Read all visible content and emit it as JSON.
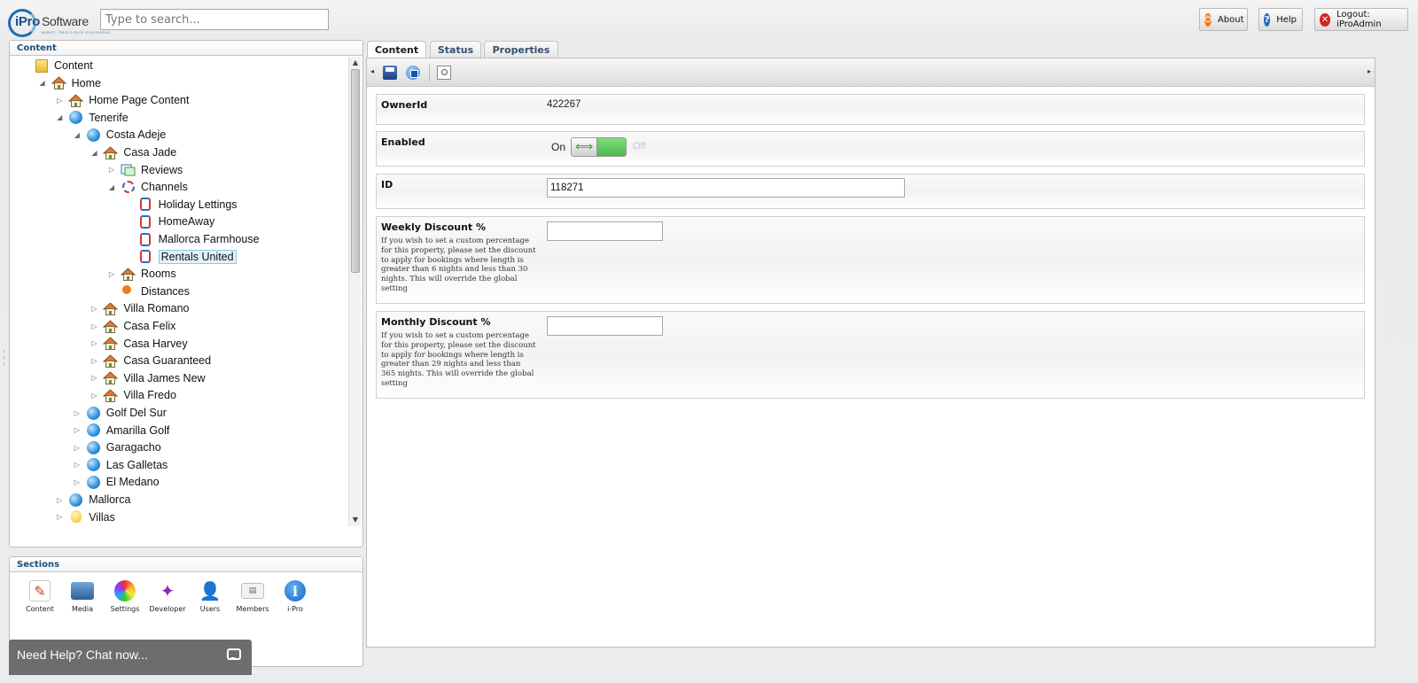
{
  "app": {
    "logo_text": "iPro",
    "logo_text2": "Software",
    "logo_tagline": "MARKET, TRACK & BOOK YOUR RENTALS",
    "search_placeholder": "Type to search..."
  },
  "topbar": {
    "about": "About",
    "help": "Help",
    "logout": "Logout: iProAdmin"
  },
  "content_panel": {
    "title": "Content",
    "tree": [
      {
        "label": "Content",
        "icon": "folder-icon",
        "toggle": ""
      },
      {
        "label": "Home",
        "icon": "house-icon",
        "toggle": "expanded"
      },
      {
        "label": "Home Page Content",
        "icon": "house-icon",
        "toggle": "collapsed"
      },
      {
        "label": "Tenerife",
        "icon": "globe-icon",
        "toggle": "expanded"
      },
      {
        "label": "Costa Adeje",
        "icon": "globe-icon",
        "toggle": "expanded"
      },
      {
        "label": "Casa Jade",
        "icon": "house-icon",
        "toggle": "expanded"
      },
      {
        "label": "Reviews",
        "icon": "reviews-icon",
        "toggle": "collapsed"
      },
      {
        "label": "Channels",
        "icon": "channel-icon",
        "toggle": "expanded"
      },
      {
        "label": "Holiday Lettings",
        "icon": "channel-icon",
        "toggle": ""
      },
      {
        "label": "HomeAway",
        "icon": "channel-icon",
        "toggle": ""
      },
      {
        "label": "Mallorca Farmhouse",
        "icon": "channel-icon",
        "toggle": ""
      },
      {
        "label": "Rentals United",
        "icon": "channel-icon",
        "toggle": "",
        "selected": true
      },
      {
        "label": "Rooms",
        "icon": "house-icon",
        "toggle": "collapsed"
      },
      {
        "label": "Distances",
        "icon": "pin-icon",
        "toggle": ""
      },
      {
        "label": "Villa Romano",
        "icon": "house-icon",
        "toggle": "collapsed"
      },
      {
        "label": "Casa Felix",
        "icon": "house-icon",
        "toggle": "collapsed"
      },
      {
        "label": "Casa Harvey",
        "icon": "house-icon",
        "toggle": "collapsed"
      },
      {
        "label": "Casa Guaranteed",
        "icon": "house-icon",
        "toggle": "collapsed"
      },
      {
        "label": "Villa James New",
        "icon": "house-icon",
        "toggle": "collapsed"
      },
      {
        "label": "Villa Fredo",
        "icon": "house-icon",
        "toggle": "collapsed"
      },
      {
        "label": "Golf Del Sur",
        "icon": "globe-icon",
        "toggle": "collapsed"
      },
      {
        "label": "Amarilla Golf",
        "icon": "globe-icon",
        "toggle": "collapsed"
      },
      {
        "label": "Garagacho",
        "icon": "globe-icon",
        "toggle": "collapsed"
      },
      {
        "label": "Las Galletas",
        "icon": "globe-icon",
        "toggle": "collapsed"
      },
      {
        "label": "El Medano",
        "icon": "globe-icon",
        "toggle": "collapsed"
      },
      {
        "label": "Mallorca",
        "icon": "globe-icon",
        "toggle": "collapsed"
      },
      {
        "label": "Villas",
        "icon": "bulb-icon",
        "toggle": "collapsed"
      }
    ]
  },
  "sections_panel": {
    "title": "Sections",
    "items": [
      {
        "label": "Content",
        "icon": "edit-icon"
      },
      {
        "label": "Media",
        "icon": "media-icon"
      },
      {
        "label": "Settings",
        "icon": "settings-icon"
      },
      {
        "label": "Developer",
        "icon": "developer-icon"
      },
      {
        "label": "Users",
        "icon": "users-icon"
      },
      {
        "label": "Members",
        "icon": "members-icon"
      },
      {
        "label": "i-Pro",
        "icon": "info-icon"
      }
    ]
  },
  "chat": {
    "label": "Need Help? Chat now..."
  },
  "tabs": [
    {
      "label": "Content",
      "active": true
    },
    {
      "label": "Status",
      "active": false
    },
    {
      "label": "Properties",
      "active": false
    }
  ],
  "form": {
    "owner_id": {
      "label": "OwnerId",
      "value": "422267"
    },
    "enabled": {
      "label": "Enabled",
      "on": "On",
      "off": "Off",
      "value": true
    },
    "id": {
      "label": "ID",
      "value": "118271"
    },
    "weekly_discount": {
      "label": "Weekly Discount %",
      "help": "If you wish to set a custom percentage for this property, please set the discount to apply for bookings where length is greater than 6 nights and less than 30 nights. This will override the global setting",
      "value": ""
    },
    "monthly_discount": {
      "label": "Monthly Discount %",
      "help": "If you wish to set a custom percentage for this property, please set the discount to apply for bookings where length is greater than 29 nights and less than 365 nights. This will override the global setting",
      "value": ""
    }
  },
  "colors": {
    "accent": "#1b6fb5",
    "toggle_on": "#5cc45c"
  }
}
